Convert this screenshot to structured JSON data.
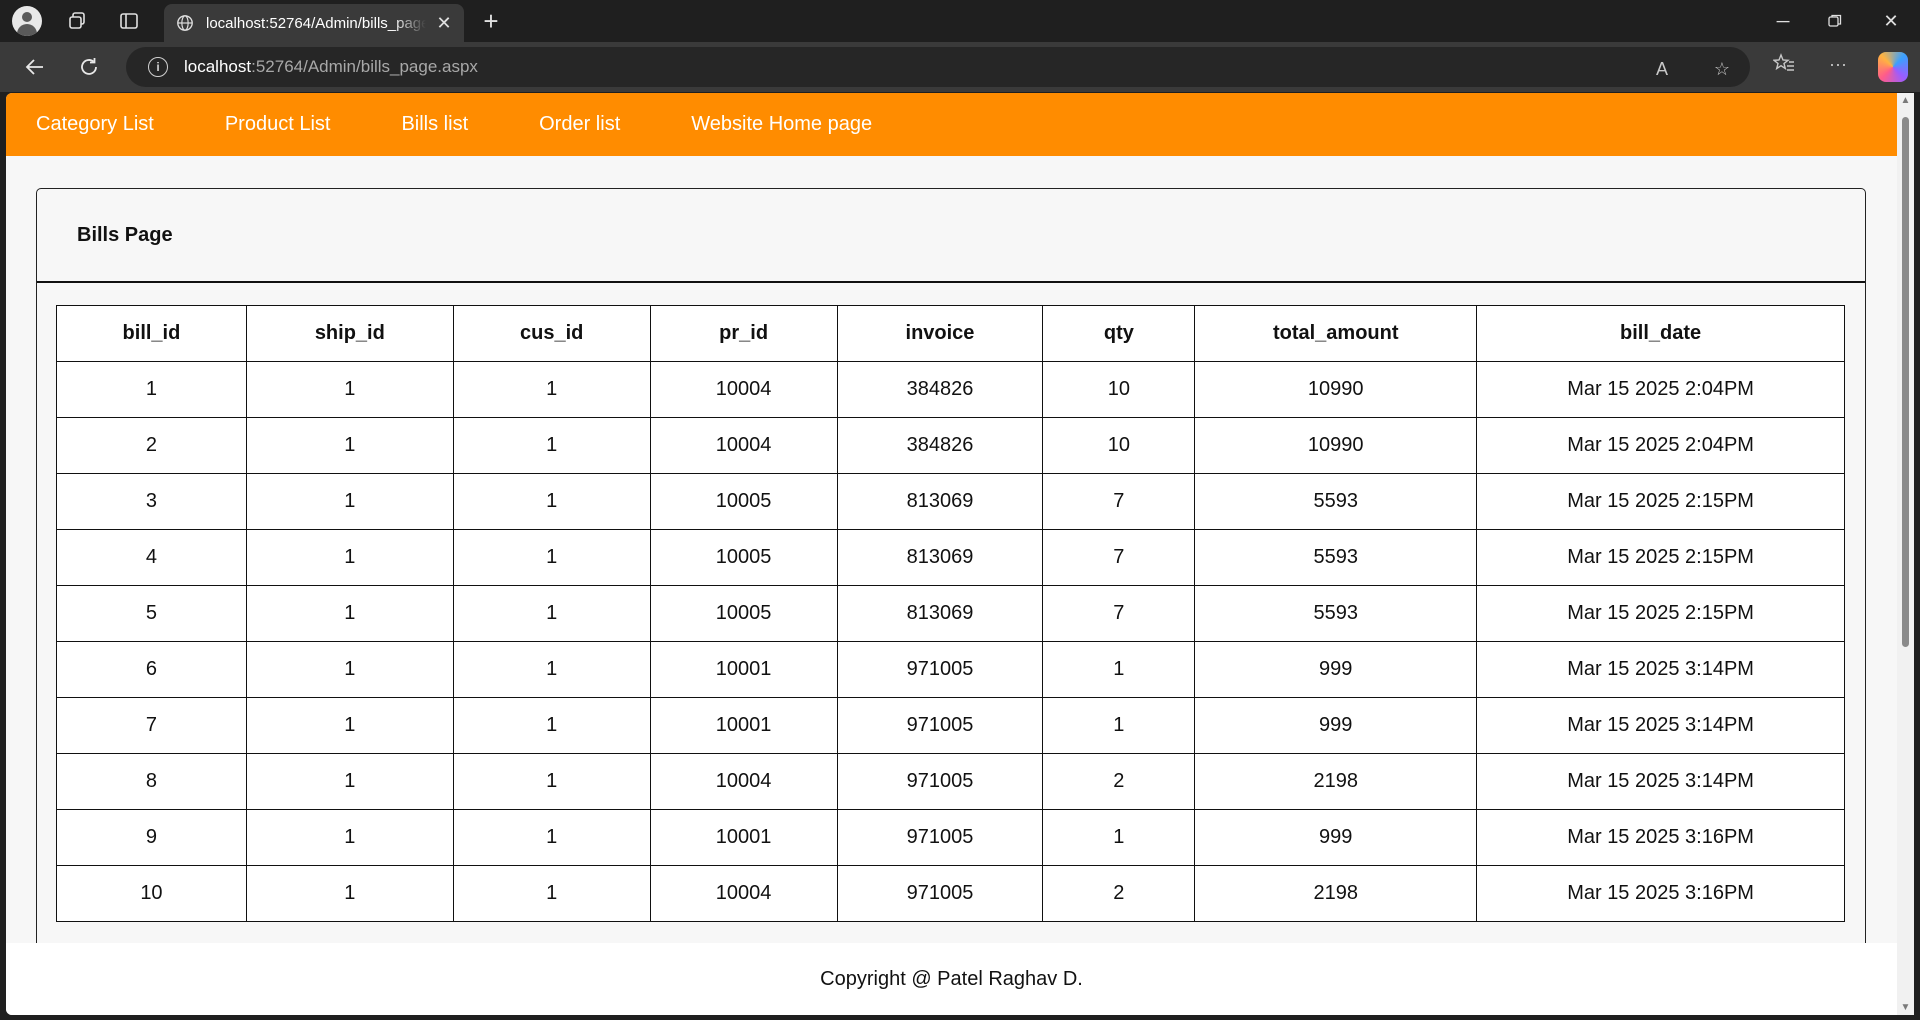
{
  "browser": {
    "tab_title": "localhost:52764/Admin/bills_page.aspx",
    "url_host": "localhost",
    "url_path": ":52764/Admin/bills_page.aspx"
  },
  "nav": {
    "items": [
      {
        "label": "Category List"
      },
      {
        "label": "Product List"
      },
      {
        "label": "Bills list"
      },
      {
        "label": "Order list"
      },
      {
        "label": "Website Home page"
      }
    ]
  },
  "page": {
    "title": "Bills Page"
  },
  "table": {
    "columns": [
      "bill_id",
      "ship_id",
      "cus_id",
      "pr_id",
      "invoice",
      "qty",
      "total_amount",
      "bill_date"
    ],
    "rows": [
      [
        "1",
        "1",
        "1",
        "10004",
        "384826",
        "10",
        "10990",
        "Mar 15 2025 2:04PM"
      ],
      [
        "2",
        "1",
        "1",
        "10004",
        "384826",
        "10",
        "10990",
        "Mar 15 2025 2:04PM"
      ],
      [
        "3",
        "1",
        "1",
        "10005",
        "813069",
        "7",
        "5593",
        "Mar 15 2025 2:15PM"
      ],
      [
        "4",
        "1",
        "1",
        "10005",
        "813069",
        "7",
        "5593",
        "Mar 15 2025 2:15PM"
      ],
      [
        "5",
        "1",
        "1",
        "10005",
        "813069",
        "7",
        "5593",
        "Mar 15 2025 2:15PM"
      ],
      [
        "6",
        "1",
        "1",
        "10001",
        "971005",
        "1",
        "999",
        "Mar 15 2025 3:14PM"
      ],
      [
        "7",
        "1",
        "1",
        "10001",
        "971005",
        "1",
        "999",
        "Mar 15 2025 3:14PM"
      ],
      [
        "8",
        "1",
        "1",
        "10004",
        "971005",
        "2",
        "2198",
        "Mar 15 2025 3:14PM"
      ],
      [
        "9",
        "1",
        "1",
        "10001",
        "971005",
        "1",
        "999",
        "Mar 15 2025 3:16PM"
      ],
      [
        "10",
        "1",
        "1",
        "10004",
        "971005",
        "2",
        "2198",
        "Mar 15 2025 3:16PM"
      ]
    ]
  },
  "footer": {
    "text": "Copyright @ Patel Raghav D."
  },
  "colors": {
    "nav_bg": "#ff8c00",
    "chrome_dark": "#1f1f1f",
    "chrome_mid": "#3a3a3a"
  }
}
